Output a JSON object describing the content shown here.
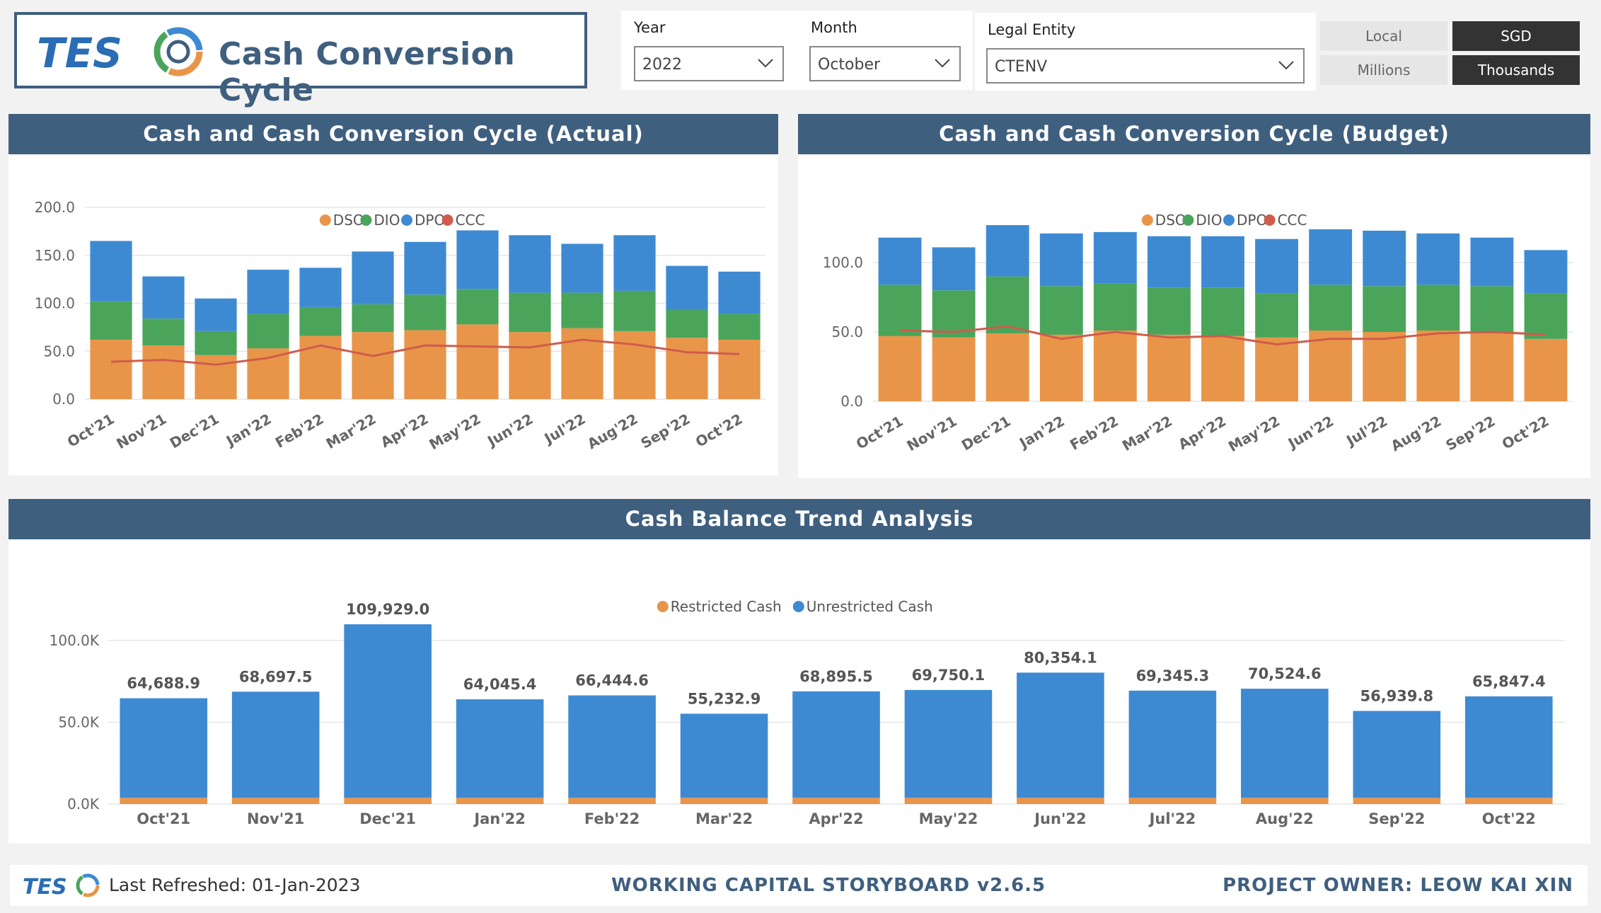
{
  "header": {
    "title": "Cash Conversion Cycle",
    "logo_text": "TES"
  },
  "filters": {
    "year": {
      "label": "Year",
      "value": "2022"
    },
    "month": {
      "label": "Month",
      "value": "October"
    },
    "entity": {
      "label": "Legal Entity",
      "value": "CTENV"
    }
  },
  "toggles": {
    "local": "Local",
    "sgd": "SGD",
    "millions": "Millions",
    "thousands": "Thousands"
  },
  "colors": {
    "header_bg": "#3f5f7f",
    "dso": "#e8954a",
    "dio": "#4aa55a",
    "dpo": "#3e8ad2",
    "ccc": "#cf5c4c",
    "restricted": "#e8954a",
    "unrestricted": "#3e8ad2"
  },
  "chart_data": [
    {
      "type": "bar",
      "stacked": true,
      "title": "Cash and Cash Conversion Cycle (Actual)",
      "categories": [
        "Oct'21",
        "Nov'21",
        "Dec'21",
        "Jan'22",
        "Feb'22",
        "Mar'22",
        "Apr'22",
        "May'22",
        "Jun'22",
        "Jul'22",
        "Aug'22",
        "Sep'22",
        "Oct'22"
      ],
      "series": [
        {
          "name": "DSO",
          "values": [
            62,
            56,
            46,
            53,
            66,
            70,
            72,
            78,
            70,
            74,
            71,
            64,
            62
          ]
        },
        {
          "name": "DIO",
          "values": [
            40,
            28,
            25,
            36,
            30,
            29,
            37,
            37,
            41,
            37,
            42,
            29,
            27
          ]
        },
        {
          "name": "DPO",
          "values": [
            63,
            44,
            34,
            46,
            41,
            55,
            55,
            61,
            60,
            51,
            58,
            46,
            44
          ]
        },
        {
          "name": "CCC",
          "type": "line",
          "values": [
            39,
            41,
            36,
            43,
            56,
            45,
            56,
            55,
            54,
            62,
            57,
            49,
            47
          ]
        }
      ],
      "ylim": [
        0,
        200
      ],
      "yticks": [
        "0.0",
        "50.0",
        "100.0",
        "150.0",
        "200.0"
      ],
      "legend": "top-center"
    },
    {
      "type": "bar",
      "stacked": true,
      "title": "Cash and Cash Conversion Cycle (Budget)",
      "categories": [
        "Oct'21",
        "Nov'21",
        "Dec'21",
        "Jan'22",
        "Feb'22",
        "Mar'22",
        "Apr'22",
        "May'22",
        "Jun'22",
        "Jul'22",
        "Aug'22",
        "Sep'22",
        "Oct'22"
      ],
      "series": [
        {
          "name": "DSO",
          "values": [
            47,
            46,
            49,
            48,
            51,
            48,
            47,
            46,
            51,
            50,
            51,
            49,
            45
          ]
        },
        {
          "name": "DIO",
          "values": [
            37,
            34,
            41,
            35,
            34,
            34,
            35,
            32,
            33,
            33,
            33,
            34,
            33
          ]
        },
        {
          "name": "DPO",
          "values": [
            34,
            31,
            37,
            38,
            37,
            37,
            37,
            39,
            40,
            40,
            37,
            35,
            31
          ]
        },
        {
          "name": "CCC",
          "type": "line",
          "values": [
            51,
            50,
            54,
            45,
            50,
            46,
            47,
            41,
            45,
            45,
            49,
            50,
            48
          ]
        }
      ],
      "ylim": [
        0,
        130
      ],
      "yticks": [
        "0.0",
        "50.0",
        "100.0"
      ],
      "legend": "top-center"
    },
    {
      "type": "bar",
      "stacked": true,
      "title": "Cash Balance Trend Analysis",
      "categories": [
        "Oct'21",
        "Nov'21",
        "Dec'21",
        "Jan'22",
        "Feb'22",
        "Mar'22",
        "Apr'22",
        "May'22",
        "Jun'22",
        "Jul'22",
        "Aug'22",
        "Sep'22",
        "Oct'22"
      ],
      "series": [
        {
          "name": "Restricted Cash",
          "values": [
            3800,
            3800,
            3800,
            3800,
            3800,
            3800,
            3800,
            3800,
            3800,
            3800,
            3800,
            3800,
            3800
          ]
        },
        {
          "name": "Unrestricted Cash",
          "values": [
            60888.9,
            64897.5,
            106129.0,
            60245.4,
            62644.6,
            51432.9,
            65095.5,
            65950.1,
            76554.1,
            65545.3,
            66724.6,
            53139.8,
            62047.4
          ]
        }
      ],
      "totals": [
        64688.9,
        68697.5,
        109929.0,
        64045.4,
        66444.6,
        55232.9,
        68895.5,
        69750.1,
        80354.1,
        69345.3,
        70524.6,
        56939.8,
        65847.4
      ],
      "total_labels": [
        "64,688.9",
        "68,697.5",
        "109,929.0",
        "64,045.4",
        "66,444.6",
        "55,232.9",
        "68,895.5",
        "69,750.1",
        "80,354.1",
        "69,345.3",
        "70,524.6",
        "56,939.8",
        "65,847.4"
      ],
      "ylim": [
        0,
        120000
      ],
      "yticks": [
        "0.0K",
        "50.0K",
        "100.0K"
      ],
      "legend": "top-center"
    }
  ],
  "footer": {
    "last_refreshed_label": "Last Refreshed:",
    "last_refreshed_value": "01-Jan-2023",
    "storyboard": "WORKING CAPITAL STORYBOARD v2.6.5",
    "owner": "PROJECT OWNER: LEOW KAI XIN"
  }
}
